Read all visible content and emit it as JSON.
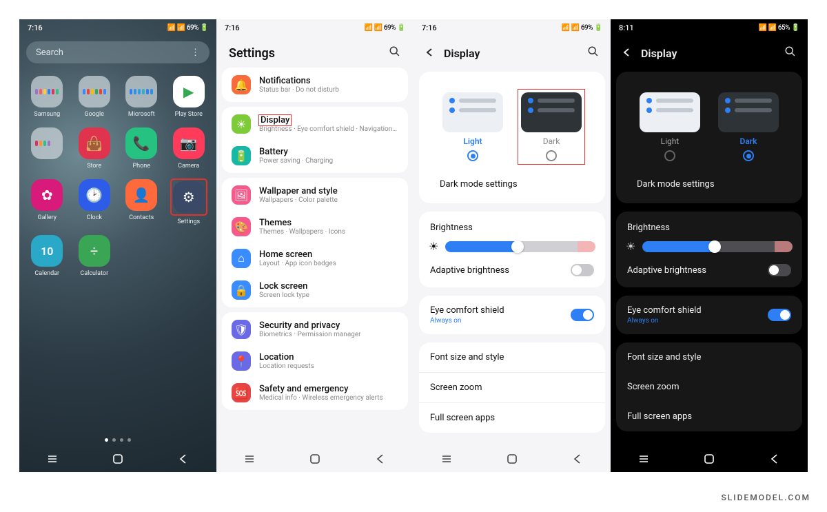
{
  "watermark": "SLIDEMODEL.COM",
  "status": {
    "t716": "7:16",
    "t811": "8:11",
    "b69": "69%",
    "b65": "65%"
  },
  "screen1": {
    "search": "Search",
    "apps": [
      {
        "label": "Samsung",
        "type": "folder",
        "c": [
          "#a070d0",
          "#ff5a5a",
          "#ffcc33",
          "#2d7ff3",
          "#e03060",
          "#30c080"
        ]
      },
      {
        "label": "Google",
        "type": "folder",
        "c": [
          "#4285f4",
          "#ea4335",
          "#fbbc05",
          "#34a853",
          "#ea4335",
          "#4285f4"
        ]
      },
      {
        "label": "Microsoft",
        "type": "folder",
        "c": [
          "#2d7ff3",
          "#2d90e0",
          "#2d9fe8",
          "#30b0c0",
          "#2d7ff3",
          "#2d90e0"
        ]
      },
      {
        "label": "Play Store",
        "type": "icon",
        "bg": "#ffffff",
        "fg": "play"
      },
      {
        "label": "",
        "type": "folder",
        "c": [
          "#e03060",
          "#ff9030",
          "#30c080",
          "#a070d0",
          "",
          ""
        ]
      },
      {
        "label": "Store",
        "type": "icon",
        "bg": "#e0334d",
        "fg": "bag"
      },
      {
        "label": "Phone",
        "type": "icon",
        "bg": "#26c281",
        "fg": "phone"
      },
      {
        "label": "Camera",
        "type": "icon",
        "bg": "#ff3b5c",
        "fg": "camera"
      },
      {
        "label": "Gallery",
        "type": "icon",
        "bg": "#d81b7a",
        "fg": "flower"
      },
      {
        "label": "Clock",
        "type": "icon",
        "bg": "#2d5de8",
        "fg": "clock"
      },
      {
        "label": "Contacts",
        "type": "icon",
        "bg": "#ff6a3c",
        "fg": "person"
      },
      {
        "label": "Settings",
        "type": "icon",
        "bg": "#3a4a66",
        "fg": "gear",
        "hl": true
      },
      {
        "label": "Calendar",
        "type": "icon",
        "bg": "#2aa8c7",
        "fg": "cal"
      },
      {
        "label": "Calculator",
        "type": "icon",
        "bg": "#3aa655",
        "fg": "calc"
      }
    ]
  },
  "screen2": {
    "title": "Settings",
    "groups": [
      [
        {
          "t": "Notifications",
          "s": "Status bar · Do not disturb",
          "bg": "#f96a3c",
          "ic": "bell"
        }
      ],
      [
        {
          "t": "Display",
          "s": "Brightness · Eye comfort shield · Navigation bar",
          "bg": "#7ecb3a",
          "ic": "sun",
          "hl": true
        },
        {
          "t": "Battery",
          "s": "Power saving · Charging",
          "bg": "#17b8a6",
          "ic": "batt"
        }
      ],
      [
        {
          "t": "Wallpaper and style",
          "s": "Wallpapers · Color palette",
          "bg": "#f55a8a",
          "ic": "img"
        },
        {
          "t": "Themes",
          "s": "Themes · Wallpapers · Icons",
          "bg": "#f55a8a",
          "ic": "theme"
        },
        {
          "t": "Home screen",
          "s": "Layout · App icon badges",
          "bg": "#3a8cff",
          "ic": "home"
        },
        {
          "t": "Lock screen",
          "s": "Screen lock type",
          "bg": "#3a8cff",
          "ic": "lock"
        }
      ],
      [
        {
          "t": "Security and privacy",
          "s": "Biometrics · Permission manager",
          "bg": "#6a6ae6",
          "ic": "shield"
        },
        {
          "t": "Location",
          "s": "Location requests",
          "bg": "#6a6ae6",
          "ic": "pin"
        },
        {
          "t": "Safety and emergency",
          "s": "Medical info · Wireless emergency alerts",
          "bg": "#e64545",
          "ic": "sos"
        }
      ]
    ]
  },
  "display": {
    "title": "Display",
    "light": "Light",
    "dark": "Dark",
    "darkmode": "Dark mode settings",
    "brightness": "Brightness",
    "adaptive": "Adaptive brightness",
    "eye": "Eye comfort shield",
    "eye_sub": "Always on",
    "font": "Font size and style",
    "zoom": "Screen zoom",
    "full": "Full screen apps"
  }
}
